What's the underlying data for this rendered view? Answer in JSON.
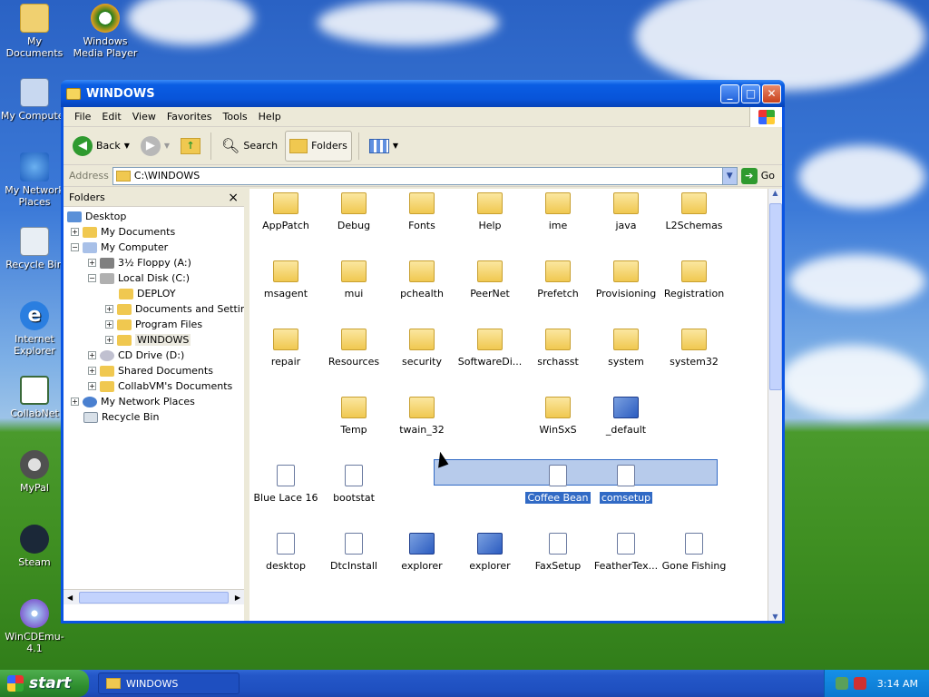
{
  "desktop": {
    "icons": [
      {
        "label": "My Documents"
      },
      {
        "label": "Windows Media Player"
      },
      {
        "label": "My Computer"
      },
      {
        "label": "My Network Places"
      },
      {
        "label": "Recycle Bin"
      },
      {
        "label": "Internet Explorer"
      },
      {
        "label": "CollabNet"
      },
      {
        "label": "MyPal"
      },
      {
        "label": "Steam"
      },
      {
        "label": "WinCDEmu-4.1"
      }
    ]
  },
  "window": {
    "title": "WINDOWS",
    "menu": [
      "File",
      "Edit",
      "View",
      "Favorites",
      "Tools",
      "Help"
    ],
    "toolbar": {
      "back": "Back",
      "search": "Search",
      "folders": "Folders"
    },
    "address": {
      "label": "Address",
      "value": "C:\\WINDOWS",
      "go": "Go"
    },
    "folders_pane": {
      "title": "Folders",
      "close": "×",
      "tree": [
        {
          "label": "Desktop"
        },
        {
          "label": "My Documents"
        },
        {
          "label": "My Computer"
        },
        {
          "label": "3½ Floppy (A:)"
        },
        {
          "label": "Local Disk (C:)"
        },
        {
          "label": "DEPLOY"
        },
        {
          "label": "Documents and Settings"
        },
        {
          "label": "Program Files"
        },
        {
          "label": "WINDOWS"
        },
        {
          "label": "CD Drive (D:)"
        },
        {
          "label": "Shared Documents"
        },
        {
          "label": "CollabVM's Documents"
        },
        {
          "label": "My Network Places"
        },
        {
          "label": "Recycle Bin"
        }
      ]
    },
    "files": [
      {
        "label": "AppPatch",
        "kind": "folder"
      },
      {
        "label": "Debug",
        "kind": "folder"
      },
      {
        "label": "Fonts",
        "kind": "folder"
      },
      {
        "label": "Help",
        "kind": "folder"
      },
      {
        "label": "ime",
        "kind": "folder"
      },
      {
        "label": "java",
        "kind": "folder"
      },
      {
        "label": "L2Schemas",
        "kind": "folder"
      },
      {
        "label": "msagent",
        "kind": "folder"
      },
      {
        "label": "mui",
        "kind": "folder"
      },
      {
        "label": "pchealth",
        "kind": "folder"
      },
      {
        "label": "PeerNet",
        "kind": "folder"
      },
      {
        "label": "Prefetch",
        "kind": "folder"
      },
      {
        "label": "Provisioning",
        "kind": "folder"
      },
      {
        "label": "Registration",
        "kind": "folder"
      },
      {
        "label": "repair",
        "kind": "folder"
      },
      {
        "label": "Resources",
        "kind": "folder"
      },
      {
        "label": "security",
        "kind": "folder"
      },
      {
        "label": "SoftwareDi...",
        "kind": "folder"
      },
      {
        "label": "srchasst",
        "kind": "folder"
      },
      {
        "label": "system",
        "kind": "folder"
      },
      {
        "label": "system32",
        "kind": "folder"
      },
      {
        "label": "Temp",
        "kind": "folder"
      },
      {
        "label": "twain_32",
        "kind": "folder"
      },
      {
        "label": "WinSxS",
        "kind": "folder"
      },
      {
        "label": "_default",
        "kind": "exe"
      },
      {
        "label": "Blue Lace 16",
        "kind": "doc"
      },
      {
        "label": "bootstat",
        "kind": "doc"
      },
      {
        "label": "Coffee Bean",
        "kind": "doc",
        "selected": true
      },
      {
        "label": "comsetup",
        "kind": "doc",
        "selected": true
      },
      {
        "label": "desktop",
        "kind": "doc"
      },
      {
        "label": "DtcInstall",
        "kind": "doc"
      },
      {
        "label": "explorer",
        "kind": "exe"
      },
      {
        "label": "explorer",
        "kind": "exe"
      },
      {
        "label": "FaxSetup",
        "kind": "doc"
      },
      {
        "label": "FeatherTex...",
        "kind": "doc"
      },
      {
        "label": "Gone Fishing",
        "kind": "doc"
      }
    ]
  },
  "taskbar": {
    "start": "start",
    "task": "WINDOWS",
    "clock": "3:14 AM"
  }
}
